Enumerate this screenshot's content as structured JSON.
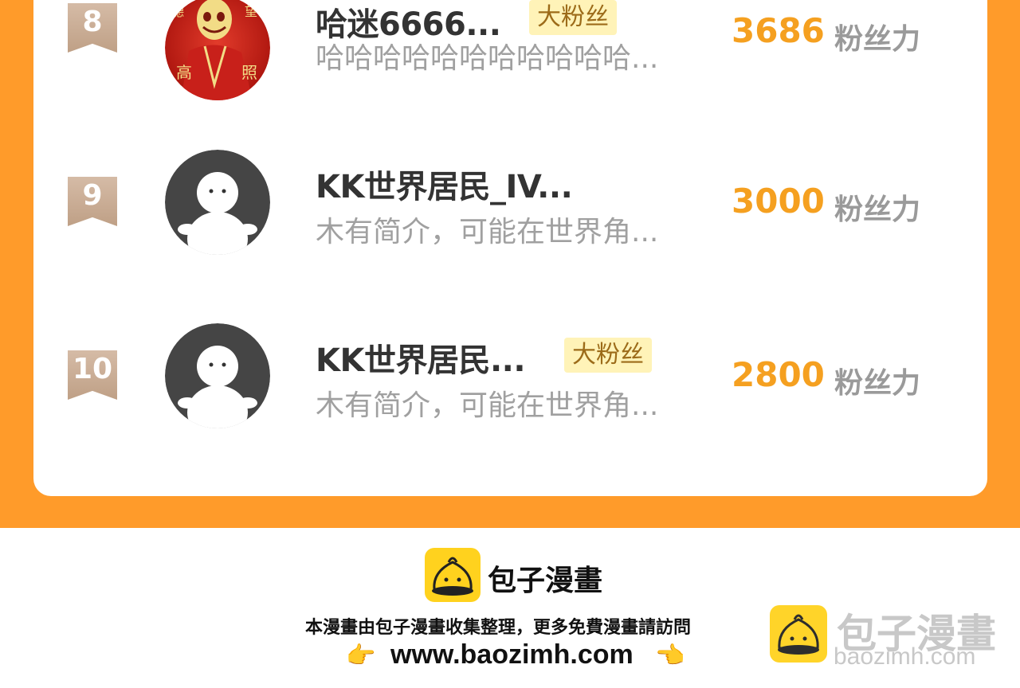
{
  "entries": [
    {
      "rank": "8",
      "name": "哈迷6666...",
      "badge": "大粉丝",
      "bio": "哈哈哈哈哈哈哈哈哈哈哈...",
      "score": "3686",
      "unit": "粉丝力"
    },
    {
      "rank": "9",
      "name": "KK世界居民_IV...",
      "badge": "",
      "bio": "木有简介，可能在世界角...",
      "score": "3000",
      "unit": "粉丝力"
    },
    {
      "rank": "10",
      "name": "KK世界居民...",
      "badge": "大粉丝",
      "bio": "木有简介，可能在世界角...",
      "score": "2800",
      "unit": "粉丝力"
    }
  ],
  "footer": {
    "brand": "包子漫畫",
    "note": "本漫畫由包子漫畫收集整理，更多免費漫畫請訪問",
    "url": "www.baozimh.com"
  },
  "watermark": {
    "brand": "包子漫畫",
    "url": "baozimh.com"
  },
  "colors": {
    "accent": "#ff9b2a",
    "score": "#f5a020",
    "badge_bg": "#fff3b8",
    "logo_yellow": "#ffd21e"
  },
  "icons": {
    "rank_ribbon": "ribbon-badge-icon",
    "avatar_red": "red-seal-avatar",
    "avatar_default": "default-person-avatar",
    "logo": "baozi-bun-icon",
    "hand_right": "pointing-right-hand-icon",
    "hand_left": "pointing-left-hand-icon"
  }
}
